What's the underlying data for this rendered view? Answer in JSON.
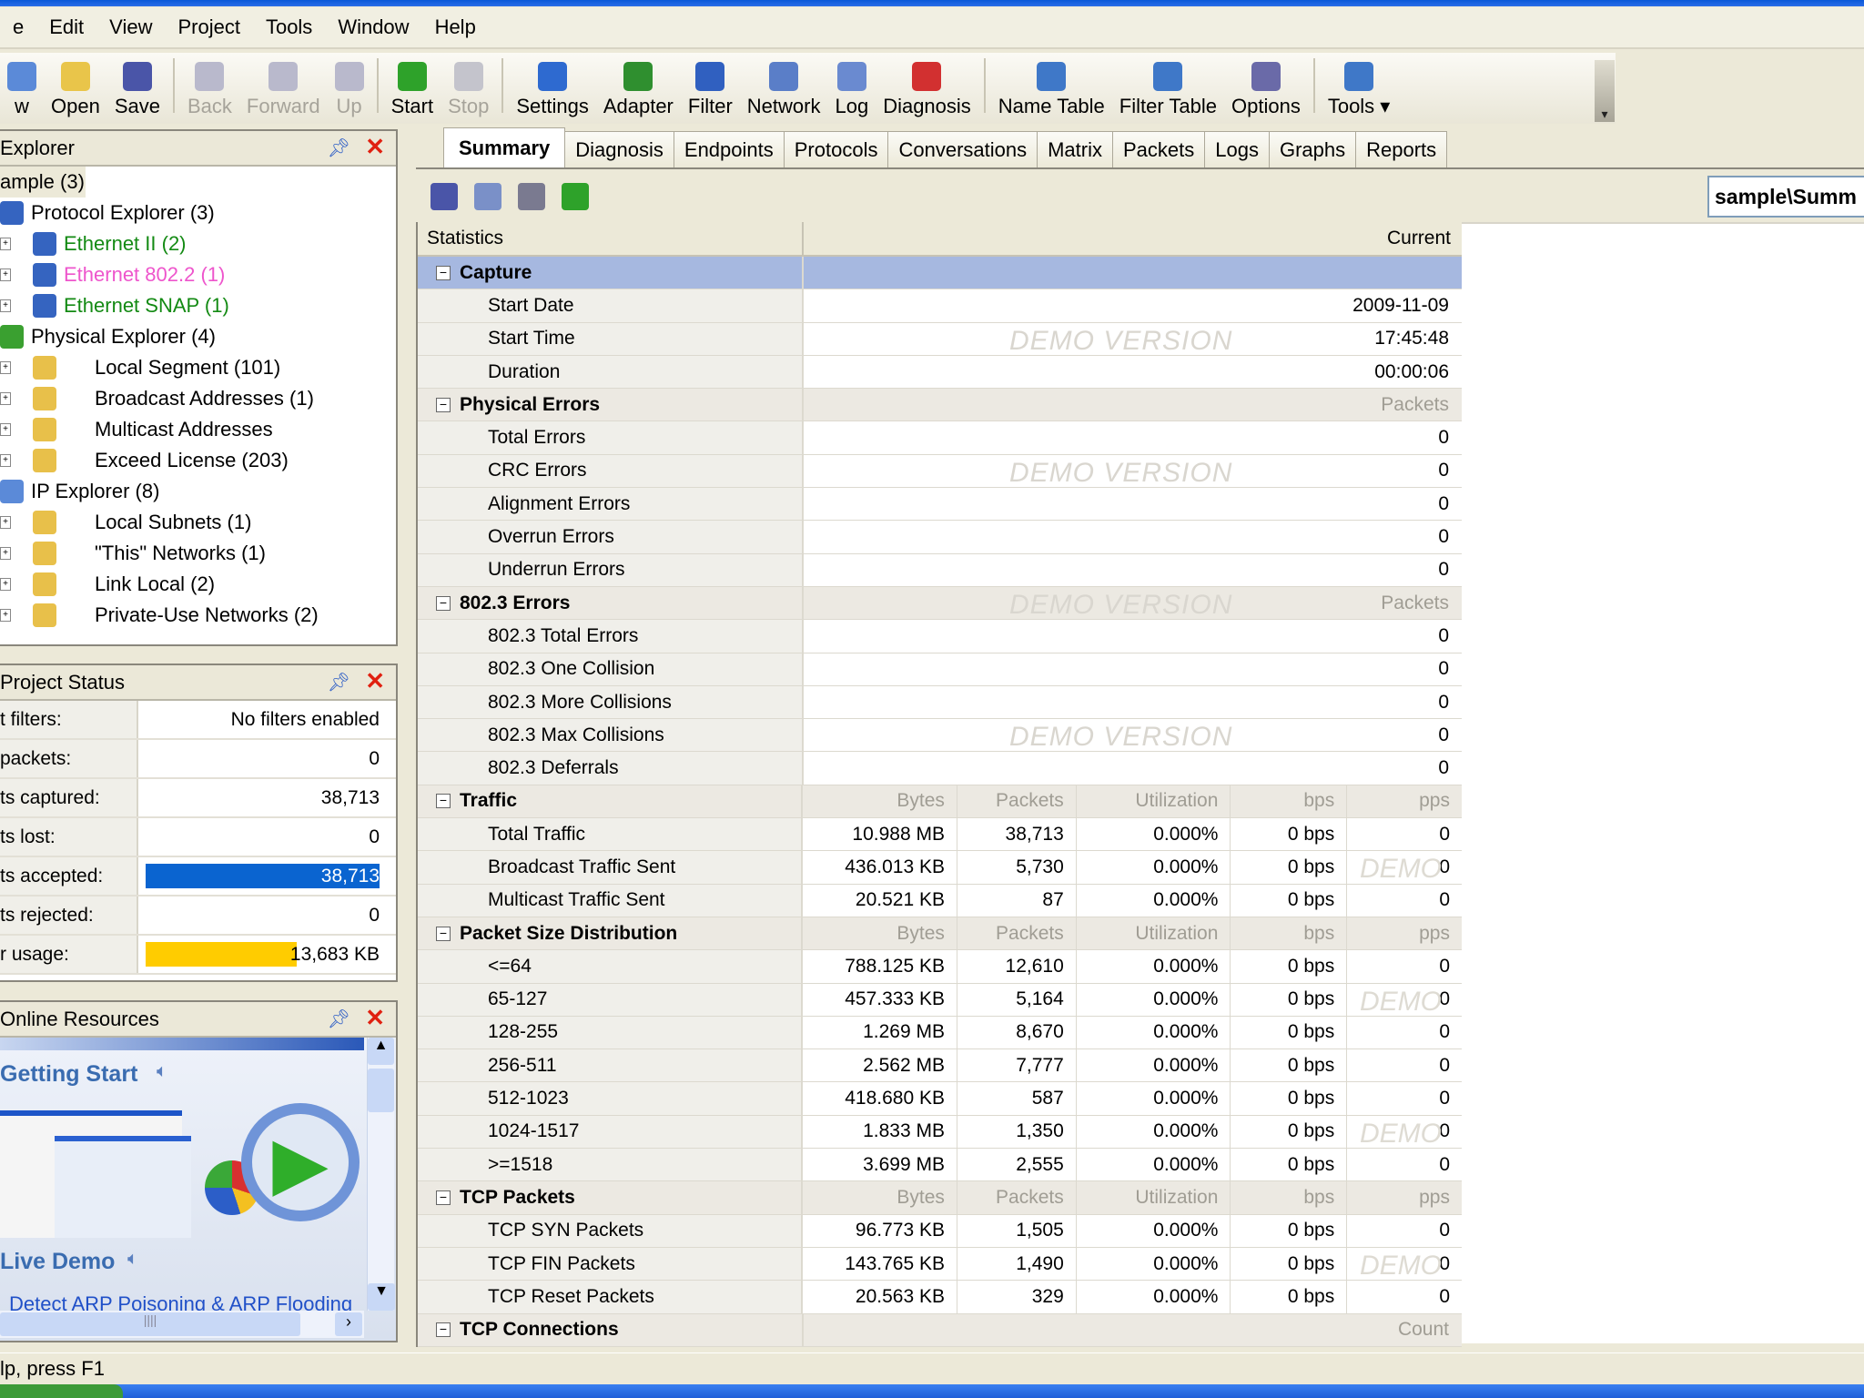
{
  "menu": [
    "e",
    "Edit",
    "View",
    "Project",
    "Tools",
    "Window",
    "Help"
  ],
  "toolbar": [
    {
      "label": "w",
      "icon": "new-icon",
      "color": "#5b8ad8"
    },
    {
      "label": "Open",
      "icon": "open-folder-icon",
      "color": "#e9c54a"
    },
    {
      "label": "Save",
      "icon": "save-icon",
      "color": "#4a55a8"
    },
    {
      "sep": true
    },
    {
      "label": "Back",
      "icon": "back-arrow-icon",
      "color": "#b9b9cc",
      "disabled": true,
      "dropdown": true
    },
    {
      "label": "Forward",
      "icon": "forward-arrow-icon",
      "color": "#b9b9cc",
      "disabled": true,
      "dropdown": true
    },
    {
      "label": "Up",
      "icon": "up-arrow-icon",
      "color": "#b9b9cc",
      "disabled": true
    },
    {
      "sep": true
    },
    {
      "label": "Start",
      "icon": "start-play-icon",
      "color": "#2ea22a"
    },
    {
      "label": "Stop",
      "icon": "stop-icon",
      "color": "#c4c4cc",
      "disabled": true
    },
    {
      "sep": true
    },
    {
      "label": "Settings",
      "icon": "settings-icon",
      "color": "#2e6ad0"
    },
    {
      "label": "Adapter",
      "icon": "adapter-icon",
      "color": "#2f8f2f"
    },
    {
      "label": "Filter",
      "icon": "filter-icon",
      "color": "#3060c0"
    },
    {
      "label": "Network",
      "icon": "network-icon",
      "color": "#5a7ec8"
    },
    {
      "label": "Log",
      "icon": "log-icon",
      "color": "#6a8ad0"
    },
    {
      "label": "Diagnosis",
      "icon": "diagnosis-icon",
      "color": "#d23030"
    },
    {
      "sep": true
    },
    {
      "label": "Name Table",
      "icon": "name-table-icon",
      "color": "#3f78c8"
    },
    {
      "label": "Filter Table",
      "icon": "filter-table-icon",
      "color": "#3f78c8"
    },
    {
      "label": "Options",
      "icon": "options-gear-icon",
      "color": "#6a6aa8"
    },
    {
      "sep": true
    },
    {
      "label": "Tools ▾",
      "icon": "tools-icon",
      "color": "#3f78c8"
    }
  ],
  "explorer": {
    "title": "Explorer",
    "items": [
      {
        "label": "ample (3)",
        "level": 0,
        "color": "#000"
      },
      {
        "label": "Protocol Explorer (3)",
        "level": 1,
        "color": "#000",
        "icon": "#3564c0"
      },
      {
        "label": "Ethernet II (2)",
        "level": 2,
        "color": "#138a13",
        "icon": "#3564c0"
      },
      {
        "label": "Ethernet 802.2 (1)",
        "level": 2,
        "color": "#ee55cc",
        "icon": "#3564c0"
      },
      {
        "label": "Ethernet SNAP (1)",
        "level": 2,
        "color": "#138a13",
        "icon": "#3564c0"
      },
      {
        "label": "Physical Explorer (4)",
        "level": 1,
        "color": "#000",
        "icon": "#3aa030"
      },
      {
        "label": "Local Segment (101)",
        "level": 3,
        "color": "#000",
        "icon": "#e8c04a"
      },
      {
        "label": "Broadcast Addresses (1)",
        "level": 3,
        "color": "#000",
        "icon": "#e8c04a"
      },
      {
        "label": "Multicast Addresses",
        "level": 3,
        "color": "#000",
        "icon": "#e8c04a"
      },
      {
        "label": "Exceed License (203)",
        "level": 3,
        "color": "#000",
        "icon": "#e8c04a"
      },
      {
        "label": "IP Explorer (8)",
        "level": 1,
        "color": "#000",
        "icon": "#5b8ad8"
      },
      {
        "label": "Local Subnets (1)",
        "level": 3,
        "color": "#000",
        "icon": "#e8c04a"
      },
      {
        "label": "\"This\" Networks (1)",
        "level": 3,
        "color": "#000",
        "icon": "#e8c04a"
      },
      {
        "label": "Link Local (2)",
        "level": 3,
        "color": "#000",
        "icon": "#e8c04a"
      },
      {
        "label": "Private-Use Networks (2)",
        "level": 3,
        "color": "#000",
        "icon": "#e8c04a"
      }
    ]
  },
  "project_status": {
    "title": "Project Status",
    "rows": [
      {
        "label": "t filters:",
        "value": "No filters enabled"
      },
      {
        "label": "packets:",
        "value": "0"
      },
      {
        "label": "ts captured:",
        "value": "38,713"
      },
      {
        "label": "ts lost:",
        "value": "0"
      },
      {
        "label": "ts accepted:",
        "value": "38,713",
        "bar_fraction": 1.0,
        "bar_color": "#0a64d0"
      },
      {
        "label": "ts rejected:",
        "value": "0"
      },
      {
        "label": "r usage:",
        "value": "13,683 KB",
        "bar_fraction": 0.65,
        "bar_color": "#ffcc00"
      }
    ]
  },
  "online": {
    "title": "Online Resources",
    "getting_started": "Getting Start",
    "live_demo": "Live Demo",
    "link": "Detect ARP Poisoning & ARP Flooding"
  },
  "tabs": [
    "Summary",
    "Diagnosis",
    "Endpoints",
    "Protocols",
    "Conversations",
    "Matrix",
    "Packets",
    "Logs",
    "Graphs",
    "Reports"
  ],
  "active_tab": "Summary",
  "path": "sample\\Summ",
  "grid": {
    "col_stats": "Statistics",
    "col_current": "Current",
    "watermark": "DEMO VERSION",
    "watermark_short": "DEMO",
    "rows": [
      {
        "g": true,
        "label": "Capture",
        "sel": true
      },
      {
        "label": "Start Date",
        "v": "2009-11-09"
      },
      {
        "label": "Start Time",
        "v": "17:45:48",
        "wm": true
      },
      {
        "label": "Duration",
        "v": "00:00:06"
      },
      {
        "g": true,
        "label": "Physical Errors",
        "v": "Packets"
      },
      {
        "label": "Total Errors",
        "v": "0"
      },
      {
        "label": "CRC Errors",
        "v": "0",
        "wm": true
      },
      {
        "label": "Alignment Errors",
        "v": "0"
      },
      {
        "label": "Overrun Errors",
        "v": "0"
      },
      {
        "label": "Underrun Errors",
        "v": "0"
      },
      {
        "g": true,
        "label": "802.3 Errors",
        "v": "Packets",
        "wm": true
      },
      {
        "label": "802.3 Total Errors",
        "v": "0"
      },
      {
        "label": "802.3 One Collision",
        "v": "0"
      },
      {
        "label": "802.3 More Collisions",
        "v": "0"
      },
      {
        "label": "802.3 Max Collisions",
        "v": "0",
        "wm": true
      },
      {
        "label": "802.3 Deferrals",
        "v": "0"
      },
      {
        "g": true,
        "label": "Traffic",
        "c": [
          "Bytes",
          "Packets",
          "Utilization",
          "bps",
          "pps"
        ]
      },
      {
        "label": "Total Traffic",
        "c": [
          "10.988 MB",
          "38,713",
          "0.000%",
          "0 bps",
          "0"
        ]
      },
      {
        "label": "Broadcast Traffic Sent",
        "c": [
          "436.013 KB",
          "5,730",
          "0.000%",
          "0 bps",
          "0"
        ],
        "wm2": true
      },
      {
        "label": "Multicast Traffic Sent",
        "c": [
          "20.521 KB",
          "87",
          "0.000%",
          "0 bps",
          "0"
        ]
      },
      {
        "g": true,
        "label": "Packet Size Distribution",
        "c": [
          "Bytes",
          "Packets",
          "Utilization",
          "bps",
          "pps"
        ]
      },
      {
        "label": "<=64",
        "c": [
          "788.125 KB",
          "12,610",
          "0.000%",
          "0 bps",
          "0"
        ]
      },
      {
        "label": "65-127",
        "c": [
          "457.333 KB",
          "5,164",
          "0.000%",
          "0 bps",
          "0"
        ],
        "wm2": true
      },
      {
        "label": "128-255",
        "c": [
          "1.269 MB",
          "8,670",
          "0.000%",
          "0 bps",
          "0"
        ]
      },
      {
        "label": "256-511",
        "c": [
          "2.562 MB",
          "7,777",
          "0.000%",
          "0 bps",
          "0"
        ]
      },
      {
        "label": "512-1023",
        "c": [
          "418.680 KB",
          "587",
          "0.000%",
          "0 bps",
          "0"
        ]
      },
      {
        "label": "1024-1517",
        "c": [
          "1.833 MB",
          "1,350",
          "0.000%",
          "0 bps",
          "0"
        ],
        "wm2": true
      },
      {
        "label": ">=1518",
        "c": [
          "3.699 MB",
          "2,555",
          "0.000%",
          "0 bps",
          "0"
        ]
      },
      {
        "g": true,
        "label": "TCP Packets",
        "c": [
          "Bytes",
          "Packets",
          "Utilization",
          "bps",
          "pps"
        ]
      },
      {
        "label": "TCP SYN Packets",
        "c": [
          "96.773 KB",
          "1,505",
          "0.000%",
          "0 bps",
          "0"
        ]
      },
      {
        "label": "TCP FIN Packets",
        "c": [
          "143.765 KB",
          "1,490",
          "0.000%",
          "0 bps",
          "0"
        ],
        "wm2": true
      },
      {
        "label": "TCP Reset Packets",
        "c": [
          "20.563 KB",
          "329",
          "0.000%",
          "0 bps",
          "0"
        ]
      },
      {
        "g": true,
        "label": "TCP Connections",
        "v": "Count"
      }
    ]
  },
  "status": "lp, press F1"
}
